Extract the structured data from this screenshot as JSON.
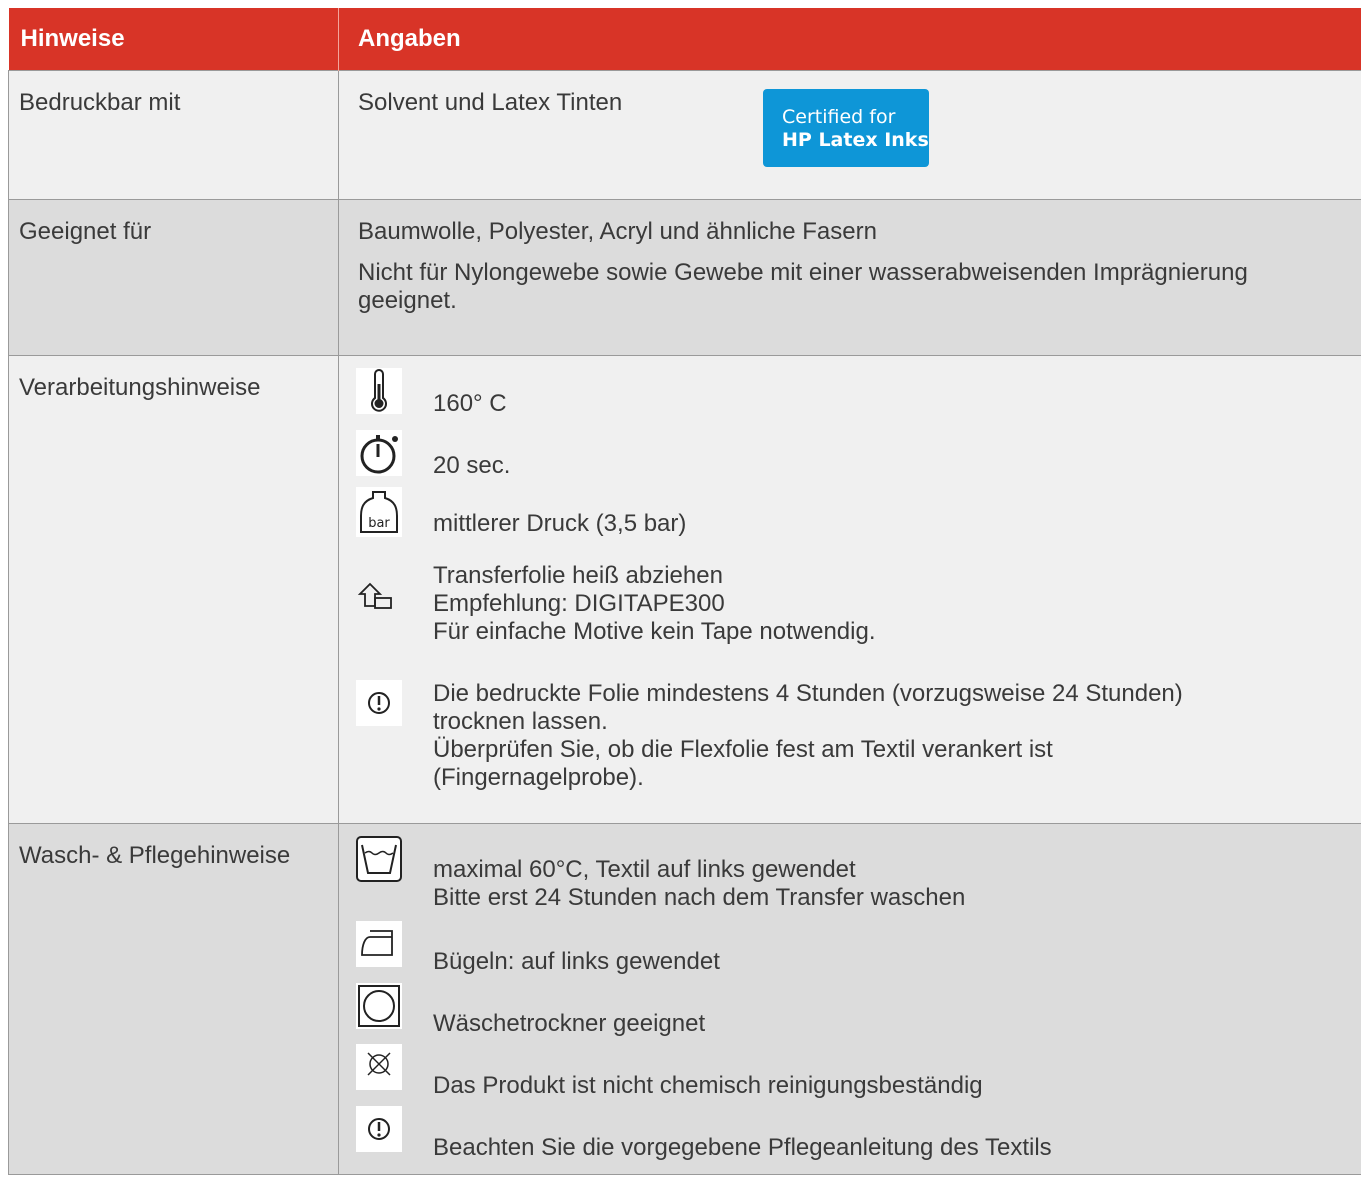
{
  "header": {
    "col1": "Hinweise",
    "col2": "Angaben"
  },
  "rows": {
    "printable": {
      "label": "Bedruckbar mit",
      "value": "Solvent und Latex Tinten",
      "badge_line1": "Certified for",
      "badge_line2": "HP Latex Inks",
      "badge_color": "#0e96d7"
    },
    "suitable": {
      "label": "Geeignet für",
      "line1": "Baumwolle, Polyester, Acryl und ähnliche Fasern",
      "line2": "Nicht für Nylongewebe sowie Gewebe mit einer wasserabweisenden Imprägnierung geeignet."
    },
    "processing": {
      "label": "Verarbeitungshinweise",
      "items": [
        {
          "icon": "thermometer-icon",
          "lines": [
            "160° C"
          ]
        },
        {
          "icon": "stopwatch-icon",
          "lines": [
            "20 sec."
          ]
        },
        {
          "icon": "pressure-weight-icon",
          "icon_text": "bar",
          "lines": [
            "mittlerer Druck (3,5 bar)"
          ]
        },
        {
          "icon": "peel-hot-icon",
          "lines": [
            "Transferfolie heiß abziehen",
            "Empfehlung: DIGITAPE300",
            "Für einfache Motive kein Tape notwendig."
          ]
        },
        {
          "icon": "exclamation-circle-icon",
          "lines": [
            "Die bedruckte Folie mindestens 4 Stunden (vorzugsweise 24 Stunden)",
            "trocknen lassen.",
            "Überprüfen Sie, ob die Flexfolie fest am Textil verankert ist",
            "(Fingernagelprobe)."
          ]
        }
      ]
    },
    "care": {
      "label": "Wasch- & Pflegehinweise",
      "items": [
        {
          "icon": "wash-tub-icon",
          "lines": [
            "maximal 60°C, Textil auf links gewendet",
            "Bitte erst 24 Stunden nach dem Transfer waschen"
          ]
        },
        {
          "icon": "iron-icon",
          "lines": [
            "Bügeln: auf links gewendet"
          ]
        },
        {
          "icon": "tumble-dryer-icon",
          "lines": [
            "Wäschetrockner geeignet"
          ]
        },
        {
          "icon": "no-dry-clean-icon",
          "lines": [
            "Das Produkt ist nicht chemisch reinigungsbeständig"
          ]
        },
        {
          "icon": "exclamation-circle-icon",
          "lines": [
            "Beachten Sie die vorgegebene Pflegeanleitung des Textils"
          ]
        }
      ]
    }
  },
  "colors": {
    "header_red": "#d83427",
    "text": "#3a3a3a",
    "row_light": "#f0f0f0",
    "row_dark": "#dcdcdc"
  }
}
